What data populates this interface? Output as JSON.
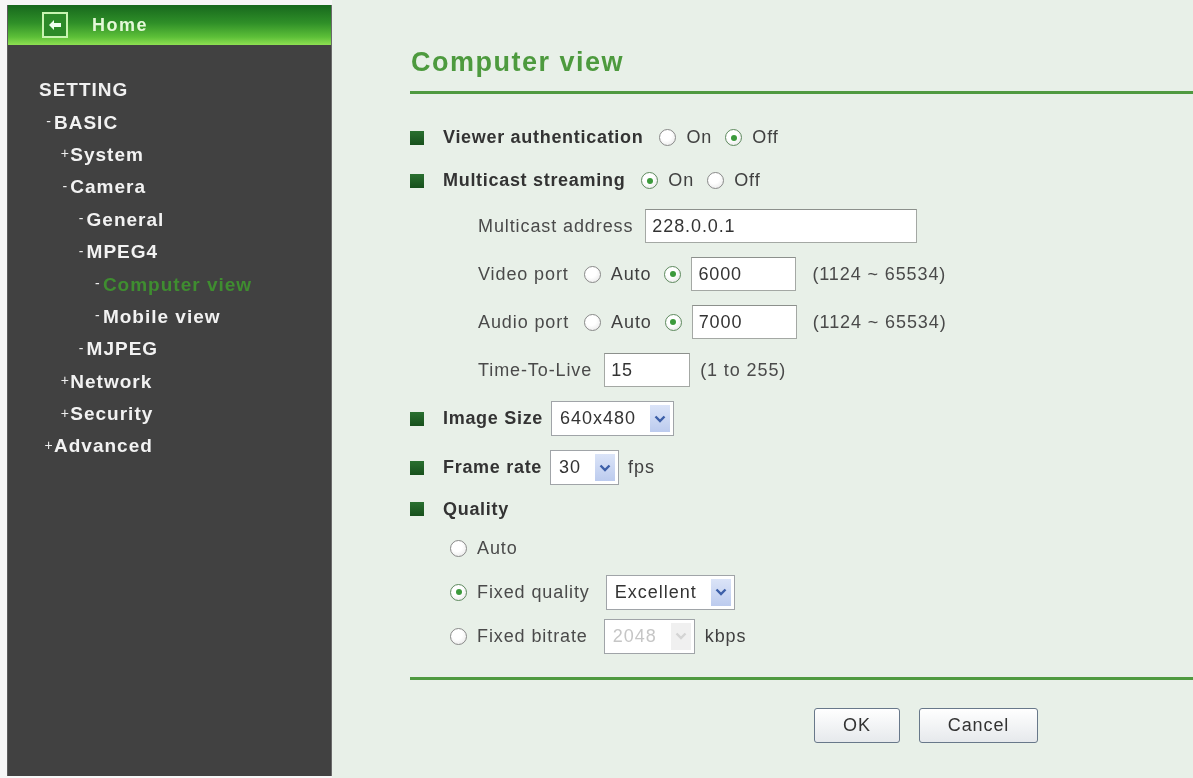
{
  "sidebar": {
    "home": "Home",
    "section_title": "SETTING",
    "tree": [
      {
        "prefix": "-",
        "label": "BASIC",
        "selected": false,
        "children": [
          {
            "prefix": "+",
            "label": "System",
            "selected": false
          },
          {
            "prefix": "-",
            "label": "Camera",
            "selected": false,
            "children": [
              {
                "prefix": "-",
                "label": "General",
                "selected": false
              },
              {
                "prefix": "-",
                "label": "MPEG4",
                "selected": false,
                "children": [
                  {
                    "prefix": "-",
                    "label": "Computer view",
                    "selected": true
                  },
                  {
                    "prefix": "-",
                    "label": "Mobile view",
                    "selected": false
                  }
                ]
              },
              {
                "prefix": "-",
                "label": "MJPEG",
                "selected": false
              }
            ]
          },
          {
            "prefix": "+",
            "label": "Network",
            "selected": false
          },
          {
            "prefix": "+",
            "label": "Security",
            "selected": false
          }
        ]
      },
      {
        "prefix": "+",
        "label": "Advanced",
        "selected": false
      }
    ]
  },
  "page": {
    "title": "Computer view"
  },
  "settings": [
    {
      "kind": "radio_group",
      "label": "Viewer authentication",
      "options": [
        {
          "label": "On",
          "selected": false
        },
        {
          "label": "Off",
          "selected": true
        }
      ]
    },
    {
      "kind": "radio_group",
      "label": "Multicast streaming",
      "options": [
        {
          "label": "On",
          "selected": true
        },
        {
          "label": "Off",
          "selected": false
        }
      ],
      "fields": [
        {
          "kind": "address",
          "label": "Multicast address",
          "value": "228.0.0.1"
        },
        {
          "kind": "port",
          "label": "Video port",
          "options": [
            {
              "label": "Auto",
              "selected": false
            },
            {
              "value": "6000",
              "selected": true
            }
          ],
          "hint": "(1124 ~ 65534)"
        },
        {
          "kind": "port",
          "label": "Audio port",
          "options": [
            {
              "label": "Auto",
              "selected": false
            },
            {
              "value": "7000",
              "selected": true
            }
          ],
          "hint": "(1124 ~ 65534)"
        },
        {
          "kind": "number",
          "label": "Time-To-Live",
          "value": "15",
          "hint": "(1 to 255)"
        }
      ]
    },
    {
      "kind": "select",
      "label": "Image Size",
      "value": "640x480"
    },
    {
      "kind": "select",
      "label": "Frame rate",
      "value": "30",
      "unit": "fps"
    },
    {
      "kind": "choice",
      "label": "Quality",
      "options": [
        {
          "label": "Auto",
          "selected": false
        },
        {
          "label": "Fixed quality",
          "selected": true,
          "select": {
            "value": "Excellent",
            "disabled": false
          }
        },
        {
          "label": "Fixed bitrate",
          "selected": false,
          "select": {
            "value": "2048",
            "disabled": true
          },
          "unit": "kbps"
        }
      ]
    }
  ],
  "buttons": [
    "OK",
    "Cancel"
  ]
}
